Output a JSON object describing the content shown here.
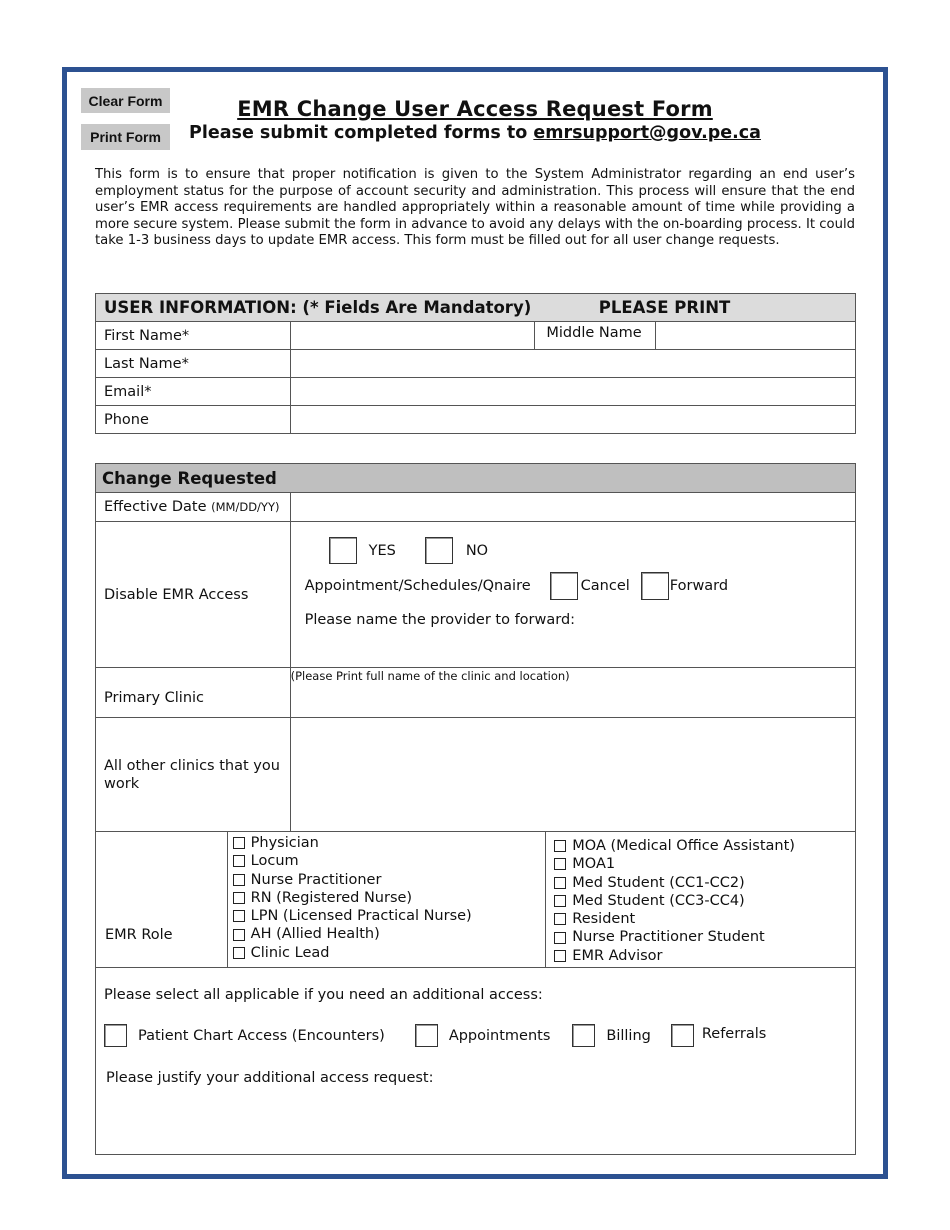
{
  "buttons": {
    "clear_form": "Clear Form",
    "print_form": "Print Form"
  },
  "header": {
    "title": "EMR Change User Access Request Form",
    "subtitle_prefix": "Please submit completed forms to ",
    "subtitle_email": "emrsupport@gov.pe.ca"
  },
  "intro": "This form is to ensure that proper notification is given to the System Administrator regarding an end user’s employment status for the purpose of account security and administration. This process will ensure that the end user’s EMR access requirements are handled appropriately within a reasonable amount of time while providing a more secure system. Please submit the form in advance to avoid any delays with the on-boarding process. It could take 1-3 business days to update EMR access. This form must be filled out for all user change requests.",
  "user_info": {
    "header": "USER INFORMATION: (* Fields Are Mandatory)",
    "header_note": "PLEASE PRINT",
    "first_name_label": "First Name*",
    "first_name_value": "",
    "middle_name_label": "Middle Name",
    "middle_name_value": "",
    "last_name_label": "Last Name*",
    "last_name_value": "",
    "email_label": "Email*",
    "email_value": "",
    "phone_label": "Phone",
    "phone_value": ""
  },
  "change_requested": {
    "header": "Change Requested",
    "effective_date_label": "Effective Date",
    "effective_date_format": "(MM/DD/YY)",
    "effective_date_value": "",
    "disable_label": "Disable EMR Access",
    "yes_label": "YES",
    "no_label": "NO",
    "appointment_label": "Appointment/Schedules/Qnaire",
    "cancel_label": "Cancel",
    "forward_label": "Forward",
    "forward_provider_label": "Please name the provider to forward:",
    "primary_clinic_label": "Primary Clinic",
    "primary_clinic_hint": "(Please Print full name of the clinic and location)",
    "other_clinics_label": "All other clinics that you work",
    "emr_role_label": "EMR Role",
    "roles_left": [
      "Physician",
      "Locum",
      "Nurse Practitioner",
      "RN (Registered Nurse)",
      "LPN (Licensed Practical Nurse)",
      "AH (Allied Health)",
      "Clinic Lead"
    ],
    "roles_right": [
      "MOA (Medical Office Assistant)",
      "MOA1",
      "Med Student (CC1-CC2)",
      "Med Student (CC3-CC4)",
      "Resident",
      "Nurse Practitioner Student",
      "EMR Advisor"
    ],
    "additional_prompt": "Please select all applicable if you need an additional access:",
    "additional_options": [
      "Patient Chart Access (Encounters)",
      "Appointments",
      "Billing",
      "Referrals"
    ],
    "justify_label": "Please justify your additional access request:"
  }
}
